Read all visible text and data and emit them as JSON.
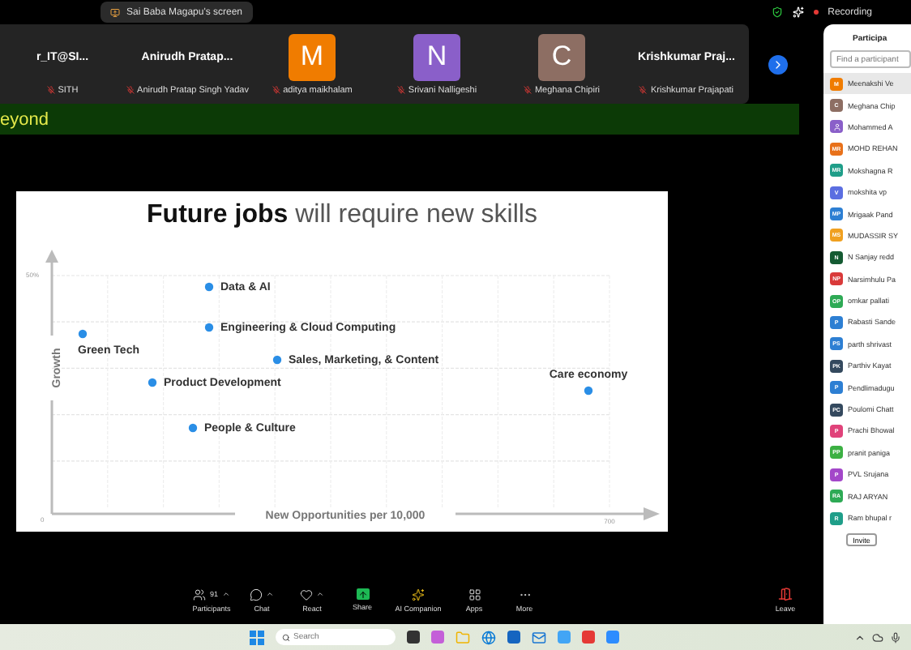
{
  "share_pill": {
    "label": "Sai Baba Magapu's screen"
  },
  "recording": {
    "label": "Recording"
  },
  "thumbnails": [
    {
      "kind": "name",
      "display": "r_IT@SI...",
      "label": "SITH"
    },
    {
      "kind": "name",
      "display": "Anirudh  Pratap...",
      "label": "Anirudh Pratap Singh Yadav"
    },
    {
      "kind": "avatar",
      "display": "M",
      "color": "#f07c00",
      "label": "aditya maikhalam"
    },
    {
      "kind": "avatar",
      "display": "N",
      "color": "#8a5fc9",
      "label": "Srivani Nalligeshi"
    },
    {
      "kind": "avatar",
      "display": "C",
      "color": "#8d6e63",
      "label": "Meghana Chipiri"
    },
    {
      "kind": "name",
      "display": "Krishkumar  Praj...",
      "label": "Krishkumar Prajapati"
    }
  ],
  "banner": {
    "text": "eyond"
  },
  "slide": {
    "title": "**Future jobs** will require new skills",
    "plot": {
      "ylabel": "Growth",
      "xlabel": "New Opportunities per 10,000",
      "y_top_label": "50%",
      "origin_label": "0",
      "x_end_label": "700",
      "points": [
        {
          "label": "Green Tech"
        },
        {
          "label": "Data & AI"
        },
        {
          "label": "Engineering & Cloud Computing"
        },
        {
          "label": "Sales, Marketing, & Content"
        },
        {
          "label": "Product Development"
        },
        {
          "label": "People & Culture"
        },
        {
          "label": "Care economy"
        }
      ]
    }
  },
  "toolbar": [
    {
      "kind": "participants",
      "label": "Participants",
      "count": "91"
    },
    {
      "kind": "chat",
      "label": "Chat"
    },
    {
      "kind": "react",
      "label": "React"
    },
    {
      "kind": "share",
      "label": "Share"
    },
    {
      "kind": "ai",
      "label": "AI Companion"
    },
    {
      "kind": "apps",
      "label": "Apps"
    },
    {
      "kind": "more",
      "label": "More"
    }
  ],
  "leave": {
    "label": "Leave"
  },
  "panel": {
    "title": "Participa",
    "search": {
      "placeholder": "Find a participant"
    },
    "participants": [
      {
        "name": "Meenakshi Ve",
        "initials": "M",
        "color": "#f07c00",
        "selected": true
      },
      {
        "name": "Meghana Chip",
        "initials": "C",
        "color": "#8d6e63",
        "selected": false
      },
      {
        "name": "Mohammed A",
        "color": "#8a5fc9",
        "selected": false
      },
      {
        "name": "MOHD REHAN",
        "initials": "MR",
        "color": "#e8711a",
        "selected": false
      },
      {
        "name": "Mokshagna R",
        "initials": "MR",
        "color": "#1f9e89",
        "selected": false
      },
      {
        "name": "mokshita vp",
        "initials": "V",
        "color": "#5b6ee1",
        "selected": false
      },
      {
        "name": "Mrigaak Pand",
        "initials": "MP",
        "color": "#2d7fd3",
        "selected": false
      },
      {
        "name": "MUDASSIR SY",
        "initials": "MS",
        "color": "#f0a020",
        "selected": false
      },
      {
        "name": "N Sanjay redd",
        "initials": "N",
        "color": "#145a32",
        "selected": false
      },
      {
        "name": "Narsimhulu Pa",
        "initials": "NP",
        "color": "#d93a3a",
        "selected": false
      },
      {
        "name": "omkar pallati",
        "initials": "OP",
        "color": "#2eaa55",
        "selected": false
      },
      {
        "name": "Rabasti Sande",
        "initials": "P",
        "color": "#2d7fd3",
        "selected": false
      },
      {
        "name": "parth shrivast",
        "initials": "PS",
        "color": "#2d7fd3",
        "selected": false
      },
      {
        "name": "Parthiv Kayat",
        "initials": "PK",
        "color": "#34495e",
        "selected": false
      },
      {
        "name": "Pendlimadugu",
        "initials": "P",
        "color": "#2d7fd3",
        "selected": false
      },
      {
        "name": "Poulomi Chatt",
        "initials": "PC",
        "color": "#34495e",
        "selected": false
      },
      {
        "name": "Prachi Bhowal",
        "initials": "P",
        "color": "#e0437a",
        "selected": false
      },
      {
        "name": "pranit paniga",
        "initials": "PP",
        "color": "#3cb043",
        "selected": false
      },
      {
        "name": "PVL Srujana",
        "initials": "P",
        "color": "#a347c9",
        "selected": false
      },
      {
        "name": "RAJ ARYAN",
        "initials": "RA",
        "color": "#2eaa55",
        "selected": false
      },
      {
        "name": "Ram bhupal r",
        "initials": "R",
        "color": "#1f9e89",
        "selected": false
      }
    ],
    "invite": "Invite"
  },
  "taskbar": {
    "search": {
      "placeholder": "Search"
    }
  }
}
